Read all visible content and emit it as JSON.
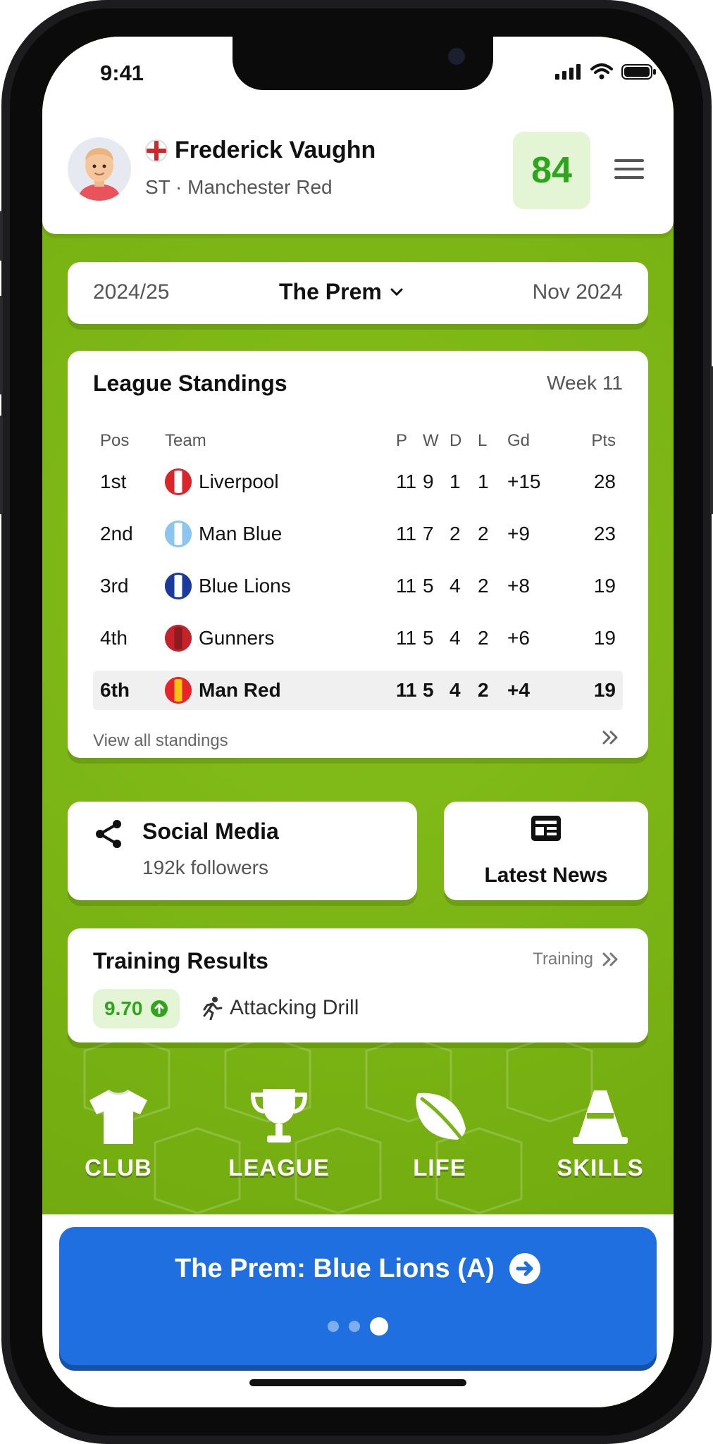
{
  "status": {
    "time": "9:41"
  },
  "player": {
    "name": "Frederick Vaughn",
    "position_club": "ST · Manchester Red",
    "rating": "84"
  },
  "season": {
    "year": "2024/25",
    "league": "The Prem",
    "date": "Nov 2024"
  },
  "standings": {
    "title": "League Standings",
    "week": "Week 11",
    "headers": {
      "pos": "Pos",
      "team": "Team",
      "p": "P",
      "w": "W",
      "d": "D",
      "l": "L",
      "gd": "Gd",
      "pts": "Pts"
    },
    "rows": [
      {
        "pos": "1st",
        "team": "Liverpool",
        "p": "11",
        "w": "9",
        "d": "1",
        "l": "1",
        "gd": "+15",
        "pts": "28",
        "color": "#d9262b",
        "stripe": "#ffffff"
      },
      {
        "pos": "2nd",
        "team": "Man Blue",
        "p": "11",
        "w": "7",
        "d": "2",
        "l": "2",
        "gd": "+9",
        "pts": "23",
        "color": "#8cc6ee",
        "stripe": "#ffffff"
      },
      {
        "pos": "3rd",
        "team": "Blue Lions",
        "p": "11",
        "w": "5",
        "d": "4",
        "l": "2",
        "gd": "+8",
        "pts": "19",
        "color": "#1a3a9c",
        "stripe": "#ffffff"
      },
      {
        "pos": "4th",
        "team": "Gunners",
        "p": "11",
        "w": "5",
        "d": "4",
        "l": "2",
        "gd": "+6",
        "pts": "19",
        "color": "#c6222a",
        "stripe": "#8c1a20"
      },
      {
        "pos": "6th",
        "team": "Man Red",
        "p": "11",
        "w": "5",
        "d": "4",
        "l": "2",
        "gd": "+4",
        "pts": "19",
        "color": "#e8242a",
        "stripe": "#f7c315"
      }
    ],
    "view_all": "View all standings"
  },
  "social": {
    "title": "Social Media",
    "followers": "192k followers"
  },
  "news": {
    "title": "Latest News"
  },
  "training": {
    "title": "Training Results",
    "link": "Training",
    "score": "9.70",
    "drill": "Attacking Drill"
  },
  "nav": {
    "club": "CLUB",
    "league": "LEAGUE",
    "life": "LIFE",
    "skills": "SKILLS"
  },
  "cta": {
    "label": "The Prem: Blue Lions (A)"
  },
  "colors": {
    "accent_green": "#2fa51e",
    "background_green": "#7ab317",
    "cta_blue": "#1f6fe0"
  }
}
